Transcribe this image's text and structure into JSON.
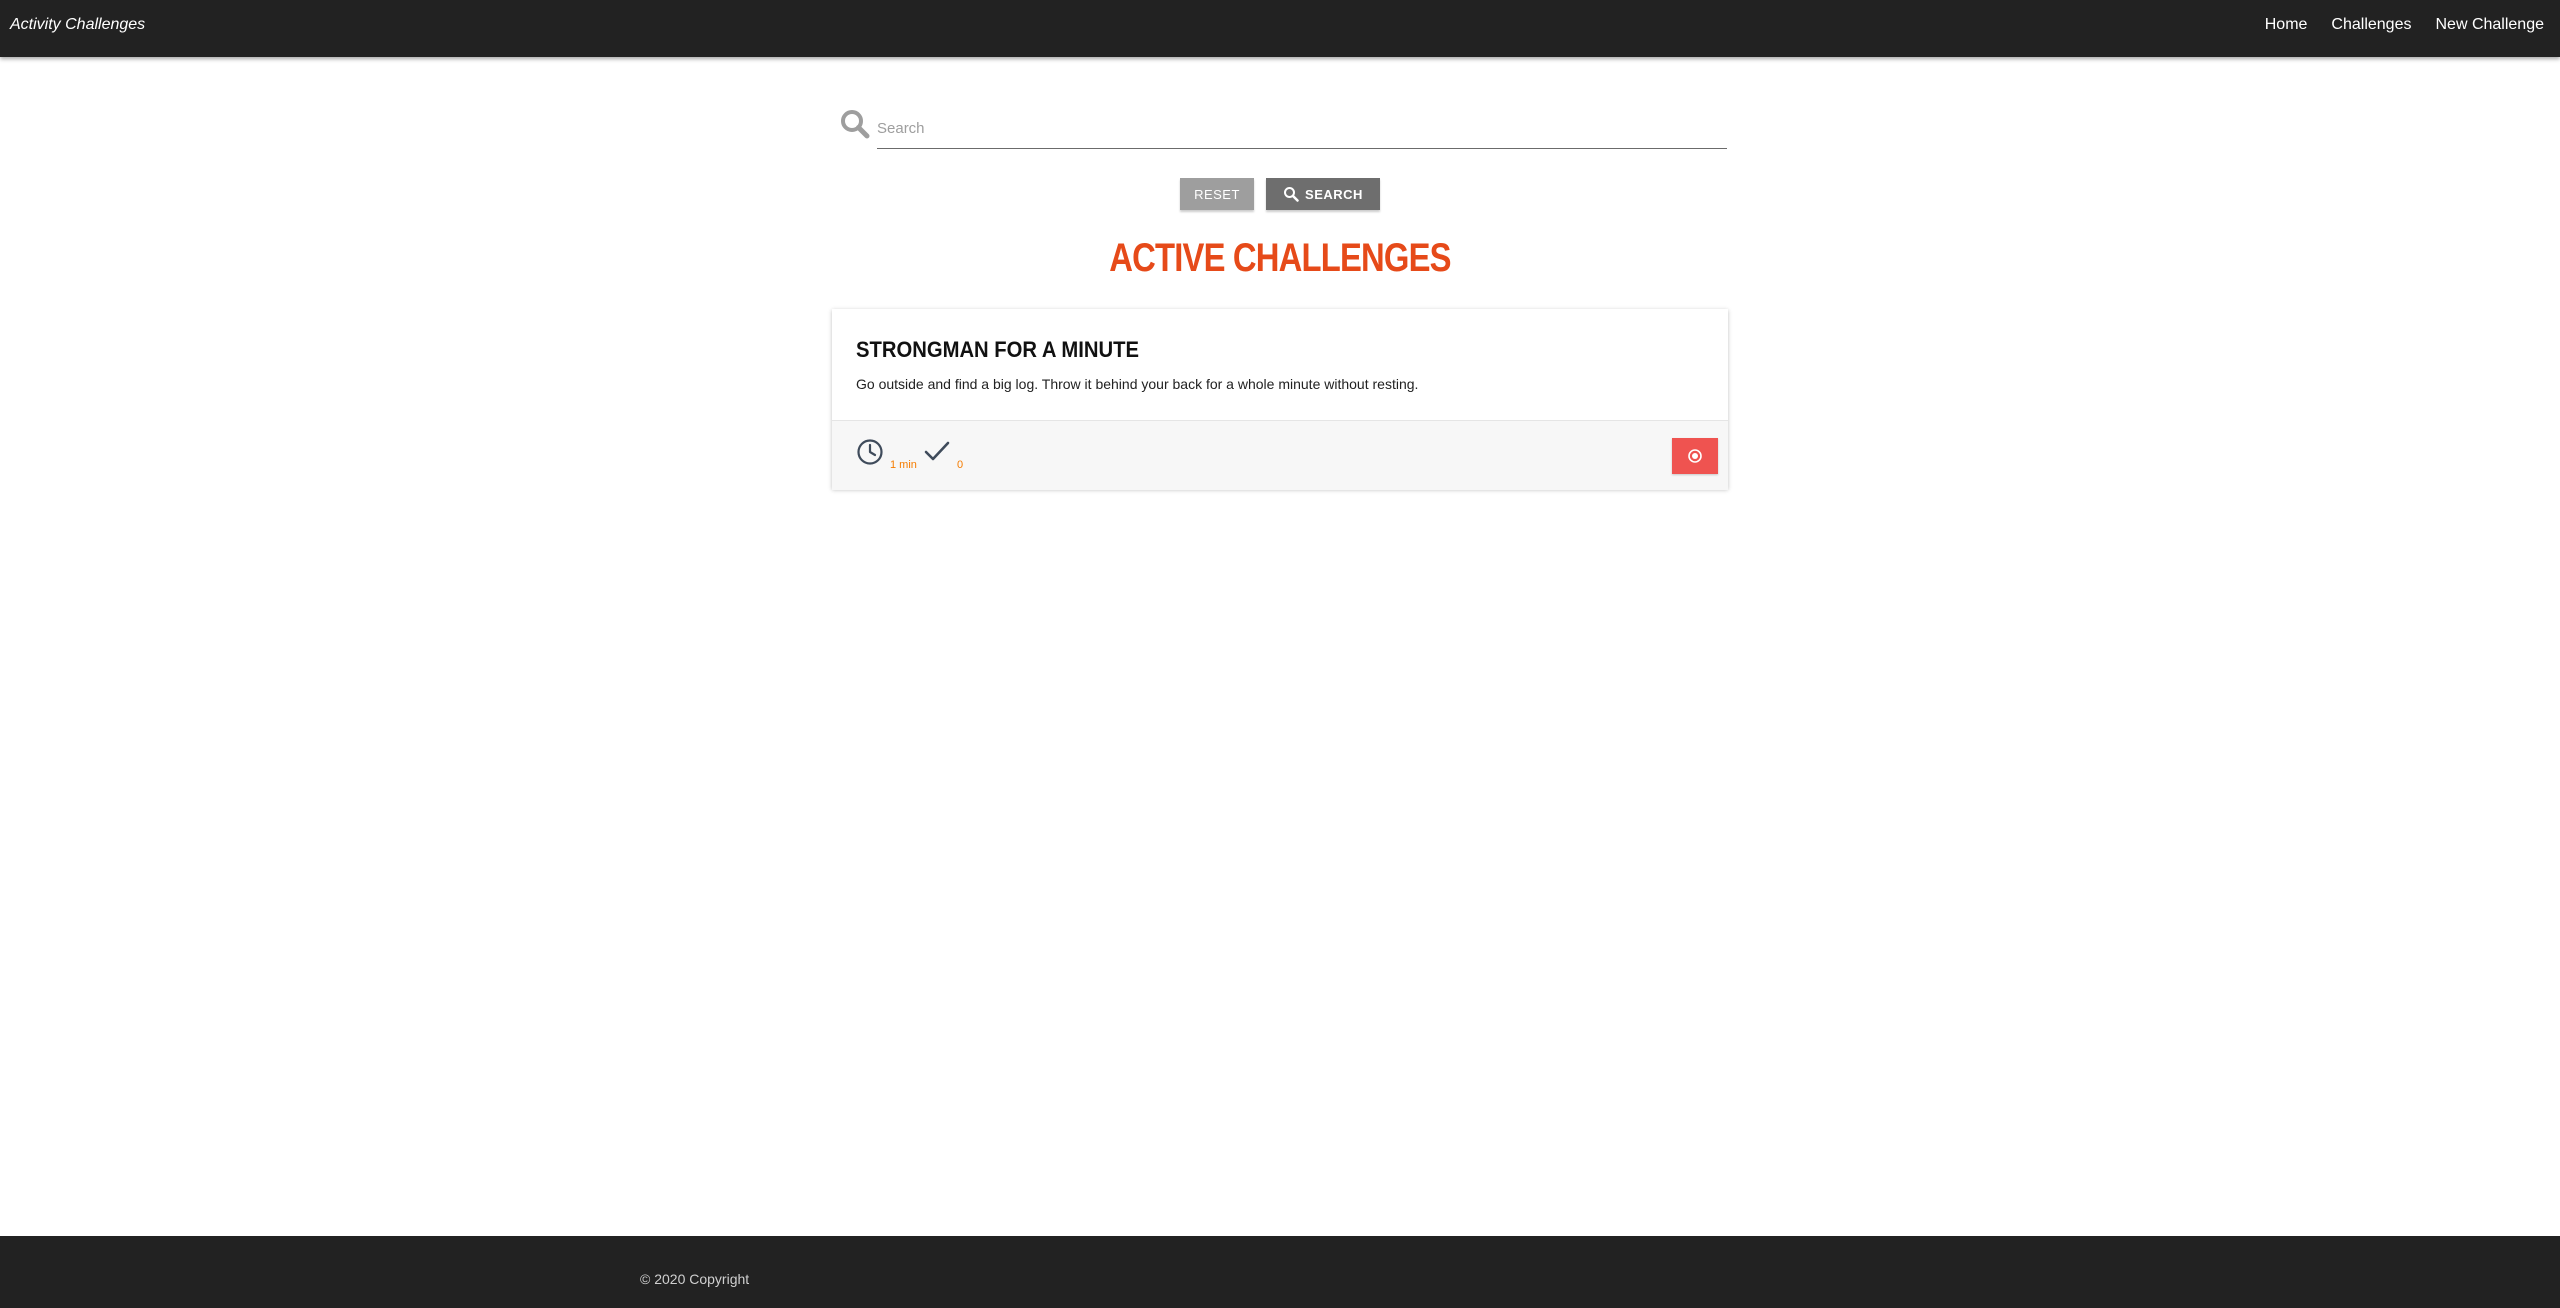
{
  "navbar": {
    "brand": "Activity Challenges",
    "links": [
      "Home",
      "Challenges",
      "New Challenge"
    ]
  },
  "search": {
    "placeholder": "Search",
    "value": "",
    "reset_label": "RESET",
    "search_label": "SEARCH"
  },
  "main": {
    "title": "ACTIVE CHALLENGES"
  },
  "challenges": [
    {
      "title": "STRONGMAN FOR A MINUTE",
      "description": "Go outside and find a big log. Throw it behind your back for a whole minute without resting.",
      "duration": "1 min",
      "completions": "0"
    }
  ],
  "footer": {
    "copyright": "© 2020 Copyright"
  },
  "colors": {
    "navbar": "#222222",
    "title": "#e64a19",
    "accent": "#f57c00",
    "join_button": "#ef5350"
  },
  "icons": {
    "search": "search-icon",
    "clock": "clock-icon",
    "check": "check-icon",
    "join": "record-icon"
  }
}
